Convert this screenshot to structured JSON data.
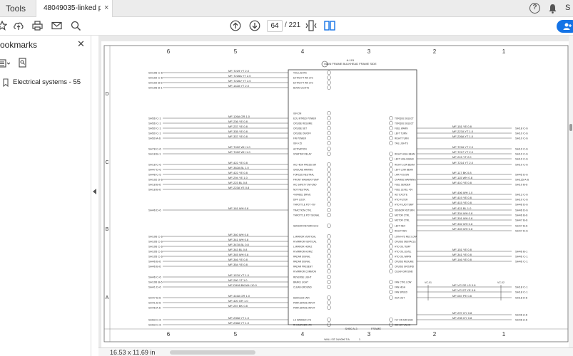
{
  "tabs": {
    "tools": "Tools",
    "document": "48049035-linked pd...",
    "close": "×"
  },
  "topbar": {
    "help": "?",
    "signin": "S"
  },
  "toolbar": {
    "page_current": "64",
    "page_total": "/ 221"
  },
  "sidebar": {
    "title": "ookmarks",
    "close": "✕",
    "items": [
      {
        "label": "Electrical systems - 55"
      }
    ]
  },
  "status": {
    "page_size": "16.53 x 11.69 in"
  },
  "drawing": {
    "top_columns": [
      "6",
      "5",
      "4",
      "3",
      "2",
      "1"
    ],
    "rows": [
      "D",
      "C",
      "B",
      "A"
    ],
    "header_code": "A-101",
    "header_title": "MAIN FRAME BULKHEAD FRAME SIDE",
    "footer_code": "SH50 A-3",
    "footer_label": "FRAME",
    "bottom_title": "WALL SIT 04/4096 T/A",
    "bottom_page": "1",
    "left_block1": [
      "SH106 C-6",
      "SH102 C-6",
      "SH102 B-6",
      "SH106 B-1"
    ],
    "left_block1_wires": [
      "MF-T229 YT 2.0",
      "MF-T226A YT 2.0",
      "MF-T226V YT 2.0",
      "MF-142A YT 2.0"
    ],
    "left_block2": [
      "SH56 C-1",
      "SH56 C-1",
      "SH50 C-1",
      "SH50 C-1",
      "SH50 A-6",
      "SH78 C-6",
      "SH18 B-1",
      "SH18 C-6",
      "SH47 D-6",
      "SH48 C-5",
      "SH102 D-6",
      "SH18 B-6",
      "SH18 B-6"
    ],
    "left_block2_wires": [
      "MF-126A OR 1.0",
      "MF-236 YE 0.8",
      "MF-237 YE 0.8",
      "MF-335 YE 0.8",
      "MF-337 YE 0.8",
      "MF-T402 WH 1.0",
      "MF-T402 WH 1.0",
      "MF-422 YE 0.8",
      "MF-362A BL 1.0",
      "MF-422 YE 0.8",
      "MF-294 YE 1.0",
      "MF-223 BL 0.8",
      "MF-223A YE 0.8"
    ],
    "left_block3": [
      "SH46 D-6"
    ],
    "left_block3_wires": [
      "MF-161 WH 0.8"
    ],
    "left_block4": [
      "SH106 C-6",
      "SH105 C-6",
      "SH106 C-6",
      "SH105 C-6",
      "SH105 C-6",
      "SH46 B-6",
      "SH46 B-6",
      "SH46 C-6",
      "SH106 B-6",
      "SH41 D-6",
      "SH47 B-6",
      "SH41 B-6",
      "SH46 A-6",
      "SH63 C-6",
      "SH63 C-6"
    ],
    "left_block4_wires": [
      "MF-340 WH 0.8",
      "MF-341 WH 0.8",
      "MF-347A BL 0.8",
      "MF-343 BL 0.8",
      "MF-345 WH 0.8",
      "MF-346 YE 0.8",
      "MF-354 YE 0.8",
      "MF-157A YT 1.0",
      "MF-260 YT 1.0",
      "MF-D998 BK/WH 10.0",
      "MF-416A OR 1.0",
      "MF-420 OR 1.0",
      "MF-257 BK 0.8",
      "MF-235A YT 1.0",
      "MF-236A YT 1.0"
    ],
    "right_wires": [
      "MF-151 YE 0.8",
      "MF-227A YT 1.0",
      "MF-226A YT 1.0",
      "MF-T216 YT 2.0",
      "MF-T217 YT 2.0",
      "MF-215 YT 2.0",
      "MF-T214 YT 2.0",
      "MF-117 BK 0.8",
      "MF-115 WH 0.8",
      "MF-410 YE 0.8",
      "MF-406 WH 1.0",
      "MF-419 YE 0.8",
      "MF-415 YE 0.8",
      "MF-421 BL 1.0",
      "MF-334 WH 0.8",
      "MF-301 WH 0.8",
      "MF-302 WH 0.8",
      "MF-303 WH 0.8",
      "MF-151 YE 0.8",
      "MF-341 YE 0.8",
      "MF-146 YE 0.8",
      "MF-VC132 LG 0.8",
      "MF-VC127 YE 0.8",
      "MF-087 PE 0.8",
      "MF-297 GY 0.8",
      "MF-298 GY 0.8"
    ],
    "right_refs": [
      "SH18 C-6",
      "SH10 C-6",
      "SH10 C-6",
      "SH10 C-6",
      "SH10 C-6",
      "SH10 C-6",
      "SH10 C-6",
      "SH45 D-6",
      "SH115 A-6",
      "SH10 B-6",
      "SH13 C-6",
      "SH10 C-6",
      "SH46 D-6",
      "SH46 D-6",
      "SH46 B-6",
      "SH47 B-6",
      "SH47 B-6",
      "SH47 D-6",
      "SH46 B-1",
      "SH46 C-1",
      "SH46 C-1",
      "SH18 C-1",
      "SH18 C-1",
      "SH18 A-6",
      "SH46 A-6",
      "SH46 A-6"
    ],
    "left_pins": [
      "TAIL LIGHTS",
      "EXTRA FT WK LTS",
      "EXTRA FT WK LTS",
      "BOOM LIGHTS",
      "IGN ON",
      "ECU MTRED POWER",
      "CRUISE RESUME",
      "CRUISE SET",
      "CRUISE ON/OFF",
      "FW POWER",
      "IGN +15",
      "ACTIVATION",
      "STARTER RELAY",
      "A/C HIGH PRESS SW",
      "GROUND ARMING",
      "FORCED NEUTRAL",
      "FRONT WASHER PUMP",
      "A/C SAFETY SW GND",
      "NOT NEUTRAL",
      "4 WHEEL DRIVE",
      "DIFF LOCK",
      "THROTTLE POT +5V",
      "TRACTION CTRL",
      "THROTTLE POT SIGNAL",
      "SENSOR RETURN ECU",
      "L MIRROR VERTICAL",
      "R MIRROR VERTICAL",
      "L MIRROR HORIZ",
      "R MIRROR HORIZ",
      "RADAR SIGNAL",
      "RADAR SIGNAL",
      "RADAR PRESENT",
      "R MIRROR COMMON",
      "REVERSE LIGHT",
      "BRAKE LIGHT",
      "CLEAN GROUND",
      "DEMOLISH AIR",
      "PARK BRAKE INPUT",
      "PARK BRAKE INPUT",
      "LH MARKER LTS",
      "RH MARKER LTS"
    ],
    "right_pins": [
      "TORQUE SELECT",
      "TORQUE SELECT",
      "FUEL WARN",
      "LEFT TURN",
      "RIGHT TURN",
      "TAIL LIGHTS",
      "RIGHT HIGH BEAM",
      "LEFT HIGH BEAM",
      "RIGHT LOW BEAM",
      "LEFT LOW BEAM",
      "LHR FOG SW",
      "CHARGE WARNING",
      "FUEL SENDER",
      "FUEL LEVEL +5V",
      "ALT EXCITE",
      "HYD FILTER",
      "HYD FLUID TEMP",
      "SENSOR RETURN",
      "MOTOR CTRL",
      "MOTOR CTRL",
      "LEFT REV",
      "RIGHT REV",
      "LOW HYD REC LOW",
      "CRUISE OBSTACLE",
      "HYD OIL TEMP",
      "HYD OIL LEVEL",
      "HYD OIL WARN",
      "CRUISE RESUME",
      "CRUISE GROUND",
      "CLEAN GROUND",
      "FAN CTRL LOW",
      "FAN HIGH",
      "FAN SPEED",
      "AUX OUT",
      "FLT OR AIR SIGN",
      "ISO AIR VALVE"
    ],
    "sub_connector_left": "VC-01",
    "sub_connector_right": "VC-02"
  }
}
